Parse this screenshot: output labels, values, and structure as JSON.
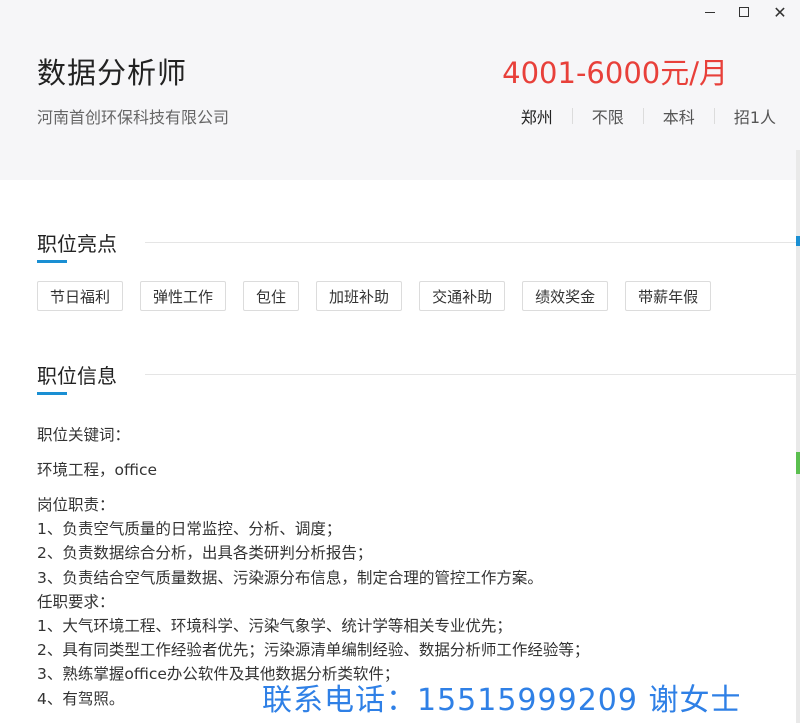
{
  "window": {
    "minimize_icon": "minimize-icon",
    "maximize_icon": "maximize-icon",
    "close_icon": "close-icon"
  },
  "job": {
    "title": "数据分析师",
    "salary": "4001-6000元/月",
    "company": "河南首创环保科技有限公司",
    "meta": {
      "city": "郑州",
      "experience": "不限",
      "education": "本科",
      "headcount": "招1人"
    }
  },
  "highlights": {
    "heading": "职位亮点",
    "tags": [
      "节日福利",
      "弹性工作",
      "包住",
      "加班补助",
      "交通补助",
      "绩效奖金",
      "带薪年假"
    ]
  },
  "info": {
    "heading": "职位信息",
    "keywords_label": "职位关键词：",
    "keywords_value": "环境工程，office",
    "lines": [
      "岗位职责：",
      "1、负责空气质量的日常监控、分析、调度；",
      "2、负责数据综合分析，出具各类研判分析报告；",
      "3、负责结合空气质量数据、污染源分布信息，制定合理的管控工作方案。",
      "任职要求：",
      "1、大气环境工程、环境科学、污染气象学、统计学等相关专业优先；",
      "2、具有同类型工作经验者优先；污染源清单编制经验、数据分析师工作经验等；",
      "3、熟练掌握office办公软件及其他数据分析类软件；",
      "4、有驾照。"
    ]
  },
  "contact": {
    "text": "联系电话：15515999209  谢女士"
  },
  "colors": {
    "accent": "#1a8fd3",
    "salary": "#e8403a",
    "contact": "#2f80e6"
  }
}
